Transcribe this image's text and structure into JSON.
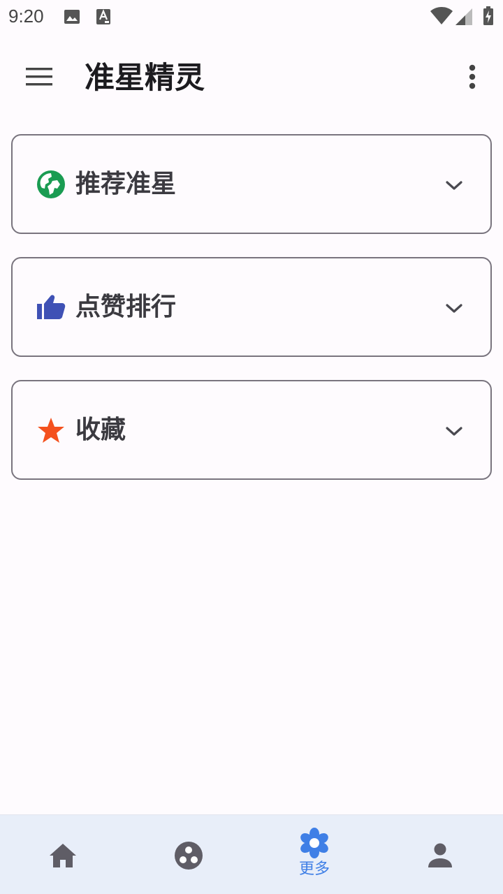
{
  "status_bar": {
    "time": "9:20",
    "icons": [
      "image-icon",
      "text-a-icon",
      "wifi-icon",
      "signal-icon",
      "battery-charging-icon"
    ]
  },
  "app_bar": {
    "title": "准星精灵",
    "menu_icon": "menu-icon",
    "overflow_icon": "more-vert-icon"
  },
  "cards": [
    {
      "label": "推荐准星",
      "icon": "globe-icon",
      "icon_color": "#1a9c52",
      "chevron": "chevron-down-icon"
    },
    {
      "label": "点赞排行",
      "icon": "thumb-up-icon",
      "icon_color": "#3f51b5",
      "chevron": "chevron-down-icon"
    },
    {
      "label": "收藏",
      "icon": "star-icon",
      "icon_color": "#f4511e",
      "chevron": "chevron-down-icon"
    }
  ],
  "bottom_nav": {
    "items": [
      {
        "icon": "home-icon",
        "label": "",
        "active": false
      },
      {
        "icon": "circles-icon",
        "label": "",
        "active": false
      },
      {
        "icon": "flower-icon",
        "label": "更多",
        "active": true
      },
      {
        "icon": "person-icon",
        "label": "",
        "active": false
      }
    ],
    "active_color": "#3f7fe6",
    "inactive_color": "#5f5d66"
  }
}
